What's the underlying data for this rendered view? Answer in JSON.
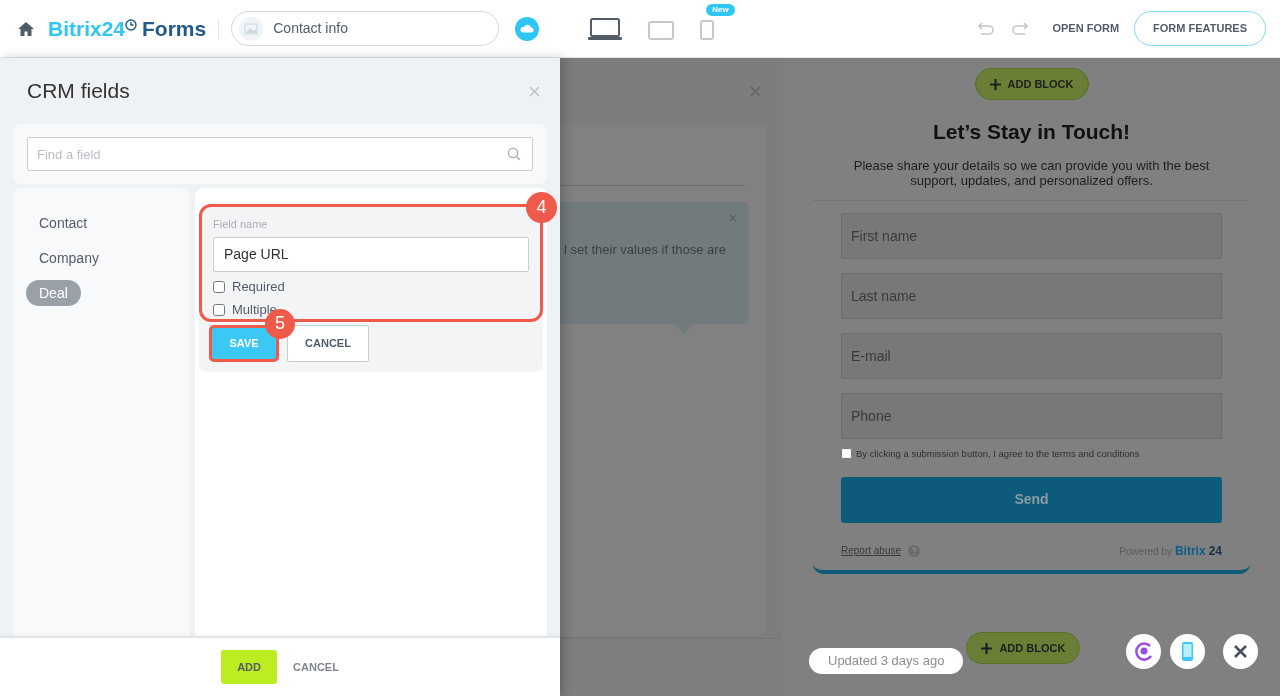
{
  "header": {
    "logo": {
      "brand": "Bitrix24",
      "product": "Forms"
    },
    "page_name": "Contact info",
    "devices": [
      {
        "kind": "laptop",
        "selected": true
      },
      {
        "kind": "tablet",
        "selected": false
      },
      {
        "kind": "phone",
        "selected": false,
        "badge": "New"
      }
    ],
    "open_form": "OPEN FORM",
    "form_features": "FORM FEATURES"
  },
  "crm_panel": {
    "title": "CRM fields",
    "search": {
      "placeholder": "Find a field"
    },
    "categories": [
      {
        "label": "Contact",
        "selected": false
      },
      {
        "label": "Company",
        "selected": false
      },
      {
        "label": "Deal",
        "selected": true
      }
    ],
    "field_editor": {
      "label": "Field name",
      "value": "Page URL",
      "options": [
        {
          "label": "Required",
          "checked": false
        },
        {
          "label": "Multiple",
          "checked": false
        }
      ],
      "save": "SAVE",
      "cancel": "CANCEL"
    },
    "callouts": [
      "4",
      "5"
    ],
    "footer": {
      "add": "ADD",
      "cancel": "CANCEL"
    }
  },
  "settings_panel": {
    "hint_text": "l set their values if those are"
  },
  "preview": {
    "add_block": "ADD BLOCK",
    "title": "Let’s Stay in Touch!",
    "subtitle": "Please share your details so we can provide you with the best support, updates, and personalized offers.",
    "fields": [
      {
        "placeholder": "First name"
      },
      {
        "placeholder": "Last name"
      },
      {
        "placeholder": "E-mail"
      },
      {
        "placeholder": "Phone"
      }
    ],
    "consent": {
      "text": "By clicking a submission button, I agree to the terms and conditions",
      "checked": false
    },
    "send": "Send",
    "report_abuse": "Report abuse",
    "powered_by": "Powered by",
    "powered_brand": "Bitrix",
    "powered_number": "24",
    "add_block_bottom": "ADD BLOCK",
    "updated": "Updated 3 days ago"
  }
}
